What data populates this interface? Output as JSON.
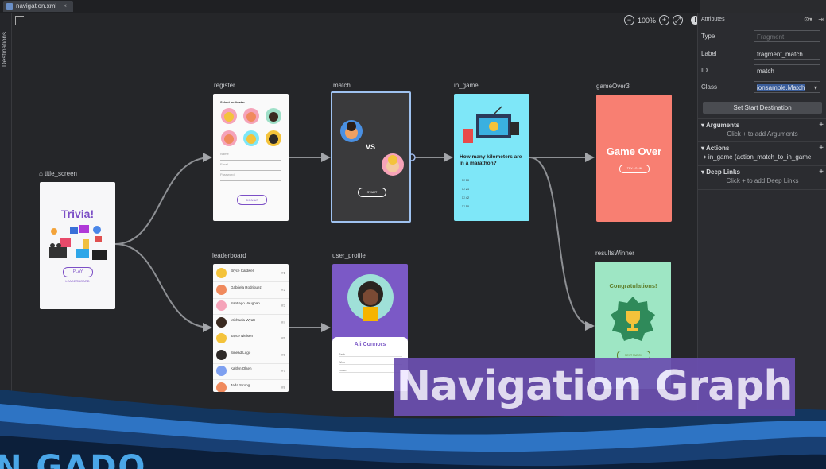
{
  "tab": {
    "label": "navigation.xml",
    "close": "×"
  },
  "sidebar": {
    "destinations_label": "Destinations"
  },
  "zoom": {
    "out": "−",
    "level": "100%",
    "in": "+",
    "fit": "⤢",
    "info": "!"
  },
  "destinations": {
    "title_screen": {
      "label": "title_screen",
      "title": "Trivia!",
      "play": "PLAY",
      "leaderboard": "LEADERBOARD"
    },
    "register": {
      "label": "register",
      "heading": "Select an Avatar",
      "name": "Name",
      "email": "Email",
      "password": "Password",
      "signup": "SIGN UP"
    },
    "match": {
      "label": "match",
      "vs": "VS",
      "start": "START"
    },
    "in_game": {
      "label": "in_game",
      "question": "How many kilometers are in a marathon?",
      "options": [
        "10",
        "21",
        "42",
        "50"
      ]
    },
    "gameOver3": {
      "label": "gameOver3",
      "title": "Game Over",
      "button": "TRY AGAIN"
    },
    "leaderboard": {
      "label": "leaderboard",
      "rows": [
        {
          "name": "Bryce Caldwell",
          "rank": "#1"
        },
        {
          "name": "Gabriela Rodriguez",
          "rank": "#2"
        },
        {
          "name": "Santiago Vaughan",
          "rank": "#3"
        },
        {
          "name": "Michaela Wyatt",
          "rank": "#4"
        },
        {
          "name": "Jayce Nielsen",
          "rank": "#5"
        },
        {
          "name": "Sinead Lugo",
          "rank": "#6"
        },
        {
          "name": "Kaitlyn Olsen",
          "rank": "#7"
        },
        {
          "name": "Jada Strong",
          "rank": "#8"
        }
      ]
    },
    "user_profile": {
      "label": "user_profile",
      "name": "Ali Connors",
      "fields": [
        "Rank",
        "Wins",
        "Losses"
      ]
    },
    "resultsWinner": {
      "label": "resultsWinner",
      "title": "Congratulations!",
      "button": "NEXT MATCH"
    }
  },
  "attributes": {
    "header": "Attributes",
    "type_label": "Type",
    "type_value": "Fragment",
    "label_label": "Label",
    "label_value": "fragment_match",
    "id_label": "ID",
    "id_value": "match",
    "class_label": "Class",
    "class_value": "ionsample.Match",
    "start_destination": "Set Start Destination",
    "arguments": "Arguments",
    "arguments_hint": "Click + to add Arguments",
    "actions": "Actions",
    "action_item": "➔ in_game (action_match_to_in_game",
    "deep_links": "Deep Links",
    "deep_links_hint": "Click + to add Deep Links"
  },
  "overlay": {
    "title": "Navigation Graph",
    "bottom_text": "N GADO"
  },
  "colors": {
    "match_bg": "#3a3a3c",
    "in_game_bg": "#7ee7f8",
    "game_over_bg": "#f87f72",
    "results_bg": "#9ee6c4",
    "profile_bg": "#7b59c6",
    "banner": "#6b4fb0"
  }
}
